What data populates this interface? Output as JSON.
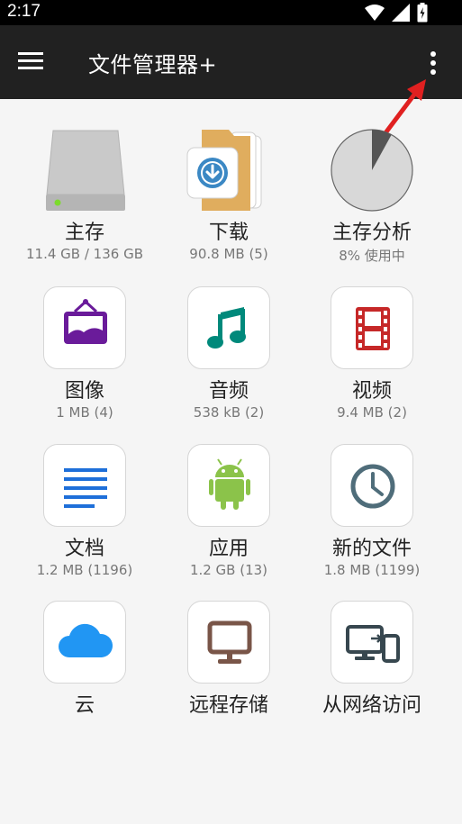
{
  "status_bar": {
    "time": "2:17"
  },
  "app_bar": {
    "title": "文件管理器+"
  },
  "tiles": [
    {
      "label": "主存",
      "sub": "11.4 GB / 136 GB"
    },
    {
      "label": "下载",
      "sub": "90.8 MB (5)"
    },
    {
      "label": "主存分析",
      "sub": "8% 使用中",
      "usage_percent": 8
    },
    {
      "label": "图像",
      "sub": "1 MB (4)"
    },
    {
      "label": "音频",
      "sub": "538 kB (2)"
    },
    {
      "label": "视频",
      "sub": "9.4 MB (2)"
    },
    {
      "label": "文档",
      "sub": "1.2 MB (1196)"
    },
    {
      "label": "应用",
      "sub": "1.2 GB (13)"
    },
    {
      "label": "新的文件",
      "sub": "1.8 MB (1199)"
    },
    {
      "label": "云",
      "sub": ""
    },
    {
      "label": "远程存储",
      "sub": ""
    },
    {
      "label": "从网络访问",
      "sub": ""
    }
  ],
  "colors": {
    "app_bar": "#212121",
    "purple": "#6a1b9a",
    "teal": "#00897b",
    "red": "#c62828",
    "blue": "#1e6fd9",
    "android_green": "#8bc34a",
    "clock": "#4f6d7a",
    "cloud": "#2196f3",
    "monitor_brown": "#795548",
    "devices": "#37474f",
    "annotation_arrow": "#e02020"
  }
}
